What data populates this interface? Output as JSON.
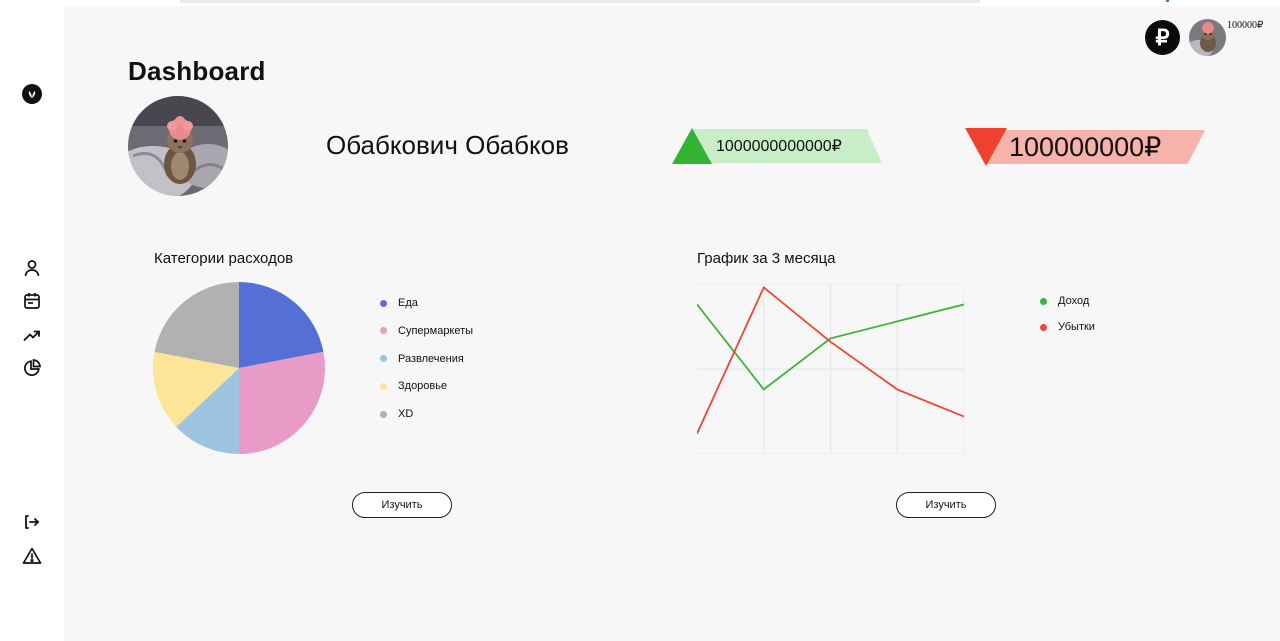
{
  "app": {
    "title": "Dashboard",
    "balance": "100000₽",
    "currency_symbol": "₽"
  },
  "sidebar": {
    "items": [
      {
        "icon": "logo-icon"
      },
      {
        "icon": "user-icon"
      },
      {
        "icon": "calendar-icon"
      },
      {
        "icon": "trending-up-icon"
      },
      {
        "icon": "pie-chart-icon"
      },
      {
        "icon": "logout-icon"
      },
      {
        "icon": "warning-icon"
      }
    ]
  },
  "profile": {
    "name": "Обабкович Обабков",
    "income": "1000000000000₽",
    "losses": "100000000₽"
  },
  "colors": {
    "income_green": "#34b233",
    "income_band": "#c9edc8",
    "loss_red": "#f04030",
    "loss_band": "#f7b2ab"
  },
  "expenses": {
    "title": "Категории расходов",
    "button_label": "Изучить"
  },
  "trend": {
    "title": "График за 3 месяца",
    "button_label": "Изучить"
  },
  "chart_data": [
    {
      "type": "pie",
      "title": "Категории расходов",
      "categories": [
        "Еда",
        "Супермаркеты",
        "Развлечения",
        "Здоровье",
        "XD"
      ],
      "values": [
        22,
        28,
        13,
        15,
        22
      ],
      "colors": [
        "#5470d6",
        "#e89bc6",
        "#9ec5e0",
        "#fde597",
        "#b1b1b1"
      ],
      "legend": "right"
    },
    {
      "type": "line",
      "title": "График за 3 месяца",
      "x": [
        0,
        1,
        2,
        3,
        4
      ],
      "series": [
        {
          "name": "Доход",
          "color": "#3cb43c",
          "values": [
            88,
            38,
            68,
            78,
            88
          ]
        },
        {
          "name": "Убытки",
          "color": "#f04536",
          "values": [
            12,
            98,
            66,
            38,
            22
          ]
        }
      ],
      "ylim": [
        0,
        100
      ],
      "grid": true,
      "legend": "right"
    }
  ]
}
